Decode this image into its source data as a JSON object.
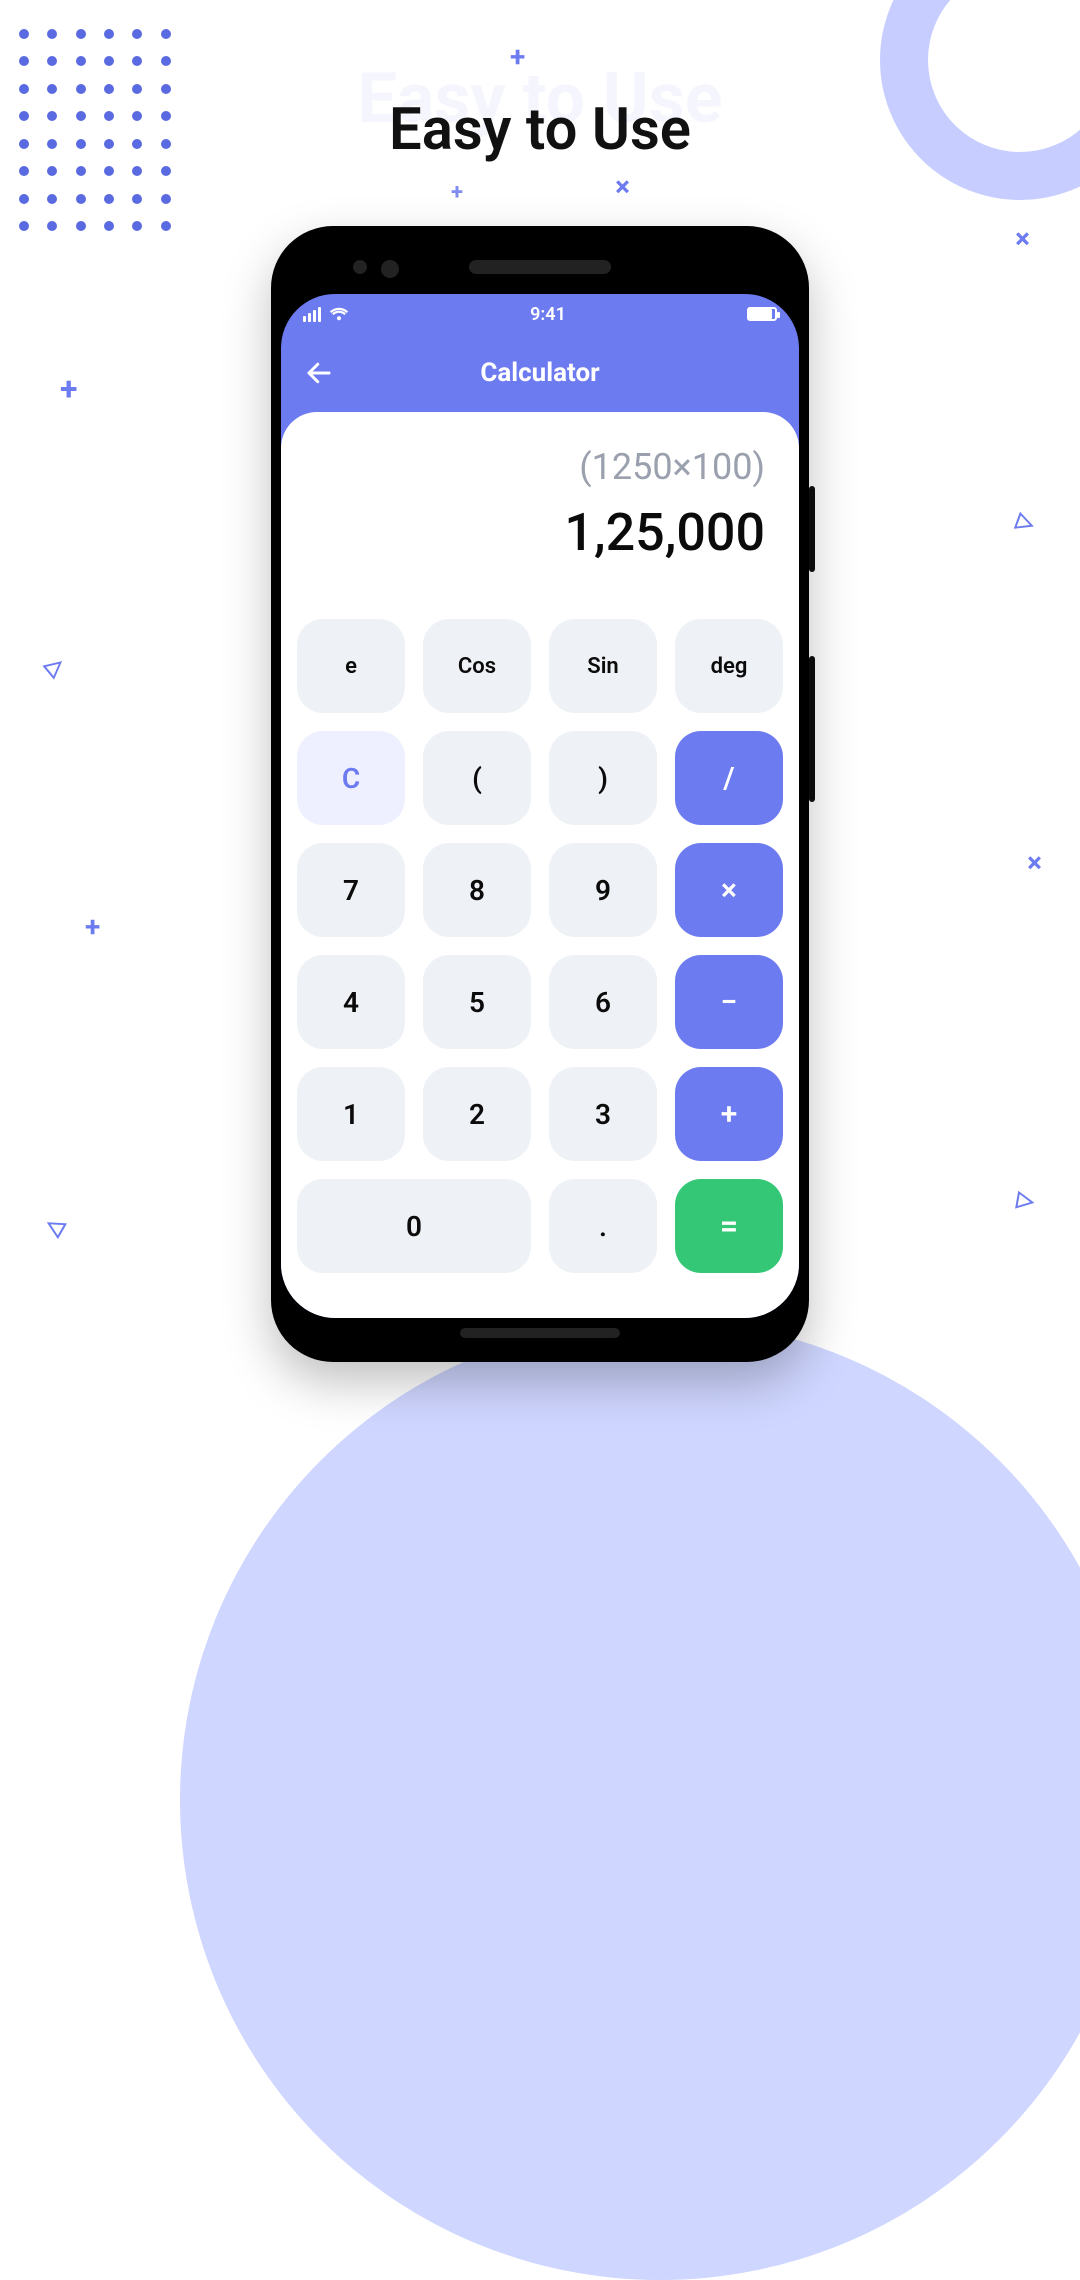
{
  "promo": {
    "heading_ghost": "Easy to Use",
    "heading": "Easy to Use"
  },
  "statusbar": {
    "time": "9:41"
  },
  "appbar": {
    "title": "Calculator"
  },
  "display": {
    "expression": "(1250×100)",
    "result": "1,25,000"
  },
  "keys": {
    "e": "e",
    "cos": "Cos",
    "sin": "Sin",
    "deg": "deg",
    "clear": "C",
    "lparen": "(",
    "rparen": ")",
    "div": "/",
    "n7": "7",
    "n8": "8",
    "n9": "9",
    "mul": "×",
    "n4": "4",
    "n5": "5",
    "n6": "6",
    "sub": "−",
    "n1": "1",
    "n2": "2",
    "n3": "3",
    "add": "+",
    "n0": "0",
    "dot": ".",
    "eq": "="
  }
}
